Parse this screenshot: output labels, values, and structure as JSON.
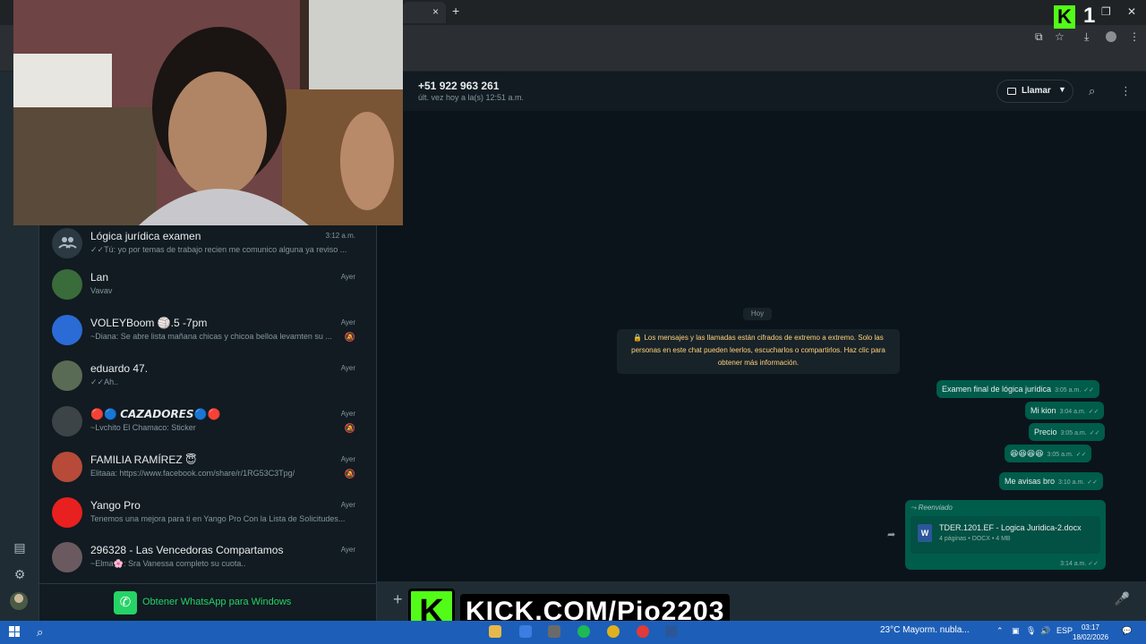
{
  "browser": {
    "tab_close": "×",
    "new_tab": "+"
  },
  "stream_overlay": {
    "kick_logo": "K",
    "viewer_count": "1",
    "banner_logo": "K",
    "banner_text": "KICK.COM/Pio2203"
  },
  "chat_list": {
    "items": [
      {
        "name": "Lógica jurídica examen",
        "time": "3:12 a.m.",
        "preview": "Tú: yo por temas de trabajo recien me comunico alguna ya reviso ...",
        "muted": false,
        "avatar_color": "#2a3942"
      },
      {
        "name": "Lan",
        "time": "Ayer",
        "preview": "Vavav",
        "muted": false,
        "avatar_color": "#3a6b3a"
      },
      {
        "name": "VOLEYBoom 🏐.5 -7pm",
        "time": "Ayer",
        "preview": "~Diana: Se abre lista mañana chicas y chicoa belloa levamten su ...",
        "muted": true,
        "avatar_color": "#2b6bd6"
      },
      {
        "name": "eduardo 47.",
        "time": "Ayer",
        "preview": "Ah..",
        "muted": false,
        "avatar_color": "#5a6b55"
      },
      {
        "name": "🔴🔵 𝘾𝘼𝙕𝘼𝘿𝙊𝙍𝙀𝙎🔵🔴",
        "time": "Ayer",
        "preview": "~Lvchito  El Chamaco: Sticker",
        "muted": true,
        "avatar_color": "#3c4448"
      },
      {
        "name": "FAMILIA RAMÍREZ 😇",
        "time": "Ayer",
        "preview": "Elitaaa: https://www.facebook.com/share/r/1RG53C3Tpg/",
        "muted": true,
        "avatar_color": "#b84a3a"
      },
      {
        "name": "Yango Pro",
        "time": "Ayer",
        "preview": "Tenemos una mejora para ti en Yango Pro Con la Lista de Solicitudes...",
        "muted": false,
        "avatar_color": "#e8201f"
      },
      {
        "name": "296328 - Las Vencedoras Compartamos",
        "time": "Ayer",
        "preview": "~Elma🌸: Sra Vanessa completo su cuota..",
        "muted": false,
        "avatar_color": "#6a5a60"
      }
    ],
    "get_whatsapp_label": "Obtener WhatsApp para Windows"
  },
  "conversation": {
    "contact_name": "+51 922 963 261",
    "contact_status": "últ. vez hoy a la(s) 12:51 a.m.",
    "call_label": "Llamar",
    "day_label": "Hoy",
    "encryption_notice": "🔒 Los mensajes y las llamadas están cifrados de extremo a extremo. Solo las personas en este chat pueden leerlos, escucharlos o compartirlos. Haz clic para obtener más información.",
    "messages": [
      {
        "text": "Examen final de lógica jurídica",
        "time": "3:05 a.m."
      },
      {
        "text": "Mi kion",
        "time": "3:04 a.m."
      },
      {
        "text": "Precio",
        "time": "3:05 a.m."
      },
      {
        "text": "😆😆😆😆",
        "time": "3:05 a.m."
      },
      {
        "text": "Me avisas bro",
        "time": "3:10 a.m."
      }
    ],
    "document": {
      "forwarded_label": "Reenviado",
      "file_name": "TDER.1201.EF - Logica Juridica-2.docx",
      "meta": "4 páginas • DOCX • 4 MB",
      "time": "3:14 a.m.",
      "icon_letter": "W"
    }
  },
  "taskbar": {
    "weather": "23°C  Mayorm. nubla...",
    "language": "ESP",
    "time": "03:17",
    "date": "18/02/2026"
  }
}
